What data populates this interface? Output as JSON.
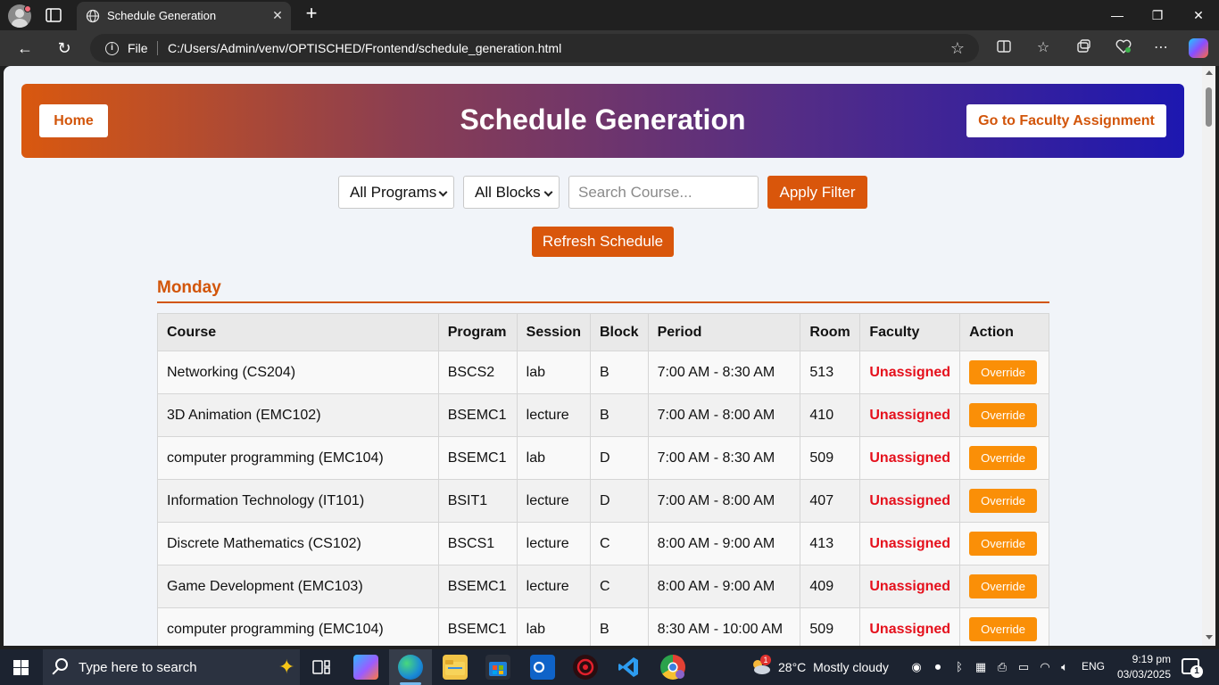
{
  "browser": {
    "tab_title": "Schedule Generation",
    "file_label": "File",
    "url": "C:/Users/Admin/venv/OPTISCHED/Frontend/schedule_generation.html"
  },
  "header": {
    "home_label": "Home",
    "title": "Schedule Generation",
    "faculty_assignment_label": "Go to Faculty Assignment",
    "gradient_colors": [
      "#d9580f",
      "#8a3e52",
      "#552d85",
      "#1d17b0"
    ]
  },
  "filters": {
    "program_selected": "All Programs",
    "block_selected": "All Blocks",
    "search_placeholder": "Search Course...",
    "search_value": "",
    "apply_label": "Apply Filter",
    "refresh_label": "Refresh Schedule"
  },
  "schedule": {
    "day": "Monday",
    "columns": [
      "Course",
      "Program",
      "Session",
      "Block",
      "Period",
      "Room",
      "Faculty",
      "Action"
    ],
    "rows": [
      {
        "course": "Networking (CS204)",
        "program": "BSCS2",
        "session": "lab",
        "block": "B",
        "period": "7:00 AM - 8:30 AM",
        "room": "513",
        "faculty": "Unassigned",
        "action": "Override"
      },
      {
        "course": "3D Animation (EMC102)",
        "program": "BSEMC1",
        "session": "lecture",
        "block": "B",
        "period": "7:00 AM - 8:00 AM",
        "room": "410",
        "faculty": "Unassigned",
        "action": "Override"
      },
      {
        "course": "computer programming (EMC104)",
        "program": "BSEMC1",
        "session": "lab",
        "block": "D",
        "period": "7:00 AM - 8:30 AM",
        "room": "509",
        "faculty": "Unassigned",
        "action": "Override"
      },
      {
        "course": "Information Technology (IT101)",
        "program": "BSIT1",
        "session": "lecture",
        "block": "D",
        "period": "7:00 AM - 8:00 AM",
        "room": "407",
        "faculty": "Unassigned",
        "action": "Override"
      },
      {
        "course": "Discrete Mathematics (CS102)",
        "program": "BSCS1",
        "session": "lecture",
        "block": "C",
        "period": "8:00 AM - 9:00 AM",
        "room": "413",
        "faculty": "Unassigned",
        "action": "Override"
      },
      {
        "course": "Game Development (EMC103)",
        "program": "BSEMC1",
        "session": "lecture",
        "block": "C",
        "period": "8:00 AM - 9:00 AM",
        "room": "409",
        "faculty": "Unassigned",
        "action": "Override"
      },
      {
        "course": "computer programming (EMC104)",
        "program": "BSEMC1",
        "session": "lab",
        "block": "B",
        "period": "8:30 AM - 10:00 AM",
        "room": "509",
        "faculty": "Unassigned",
        "action": "Override"
      }
    ]
  },
  "colors": {
    "accent": "#d9560b",
    "override": "#fa8f07",
    "unassigned": "#e5101c"
  },
  "taskbar": {
    "search_placeholder": "Type here to search",
    "weather_temp": "28°C",
    "weather_desc": "Mostly cloudy",
    "weather_badge": "1",
    "language": "ENG",
    "time": "9:19 pm",
    "date": "03/03/2025",
    "notification_count": "1"
  }
}
